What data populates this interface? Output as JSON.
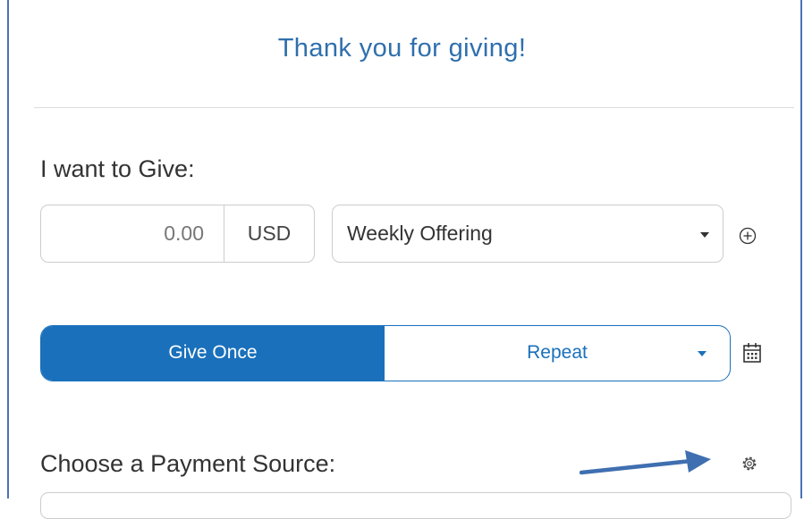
{
  "header": {
    "title": "Thank you for giving!"
  },
  "give_section": {
    "heading": "I want to Give:",
    "amount_value": "0.00",
    "currency": "USD",
    "fund_selected": "Weekly Offering",
    "add_fund_icon": "plus-circle-icon"
  },
  "frequency": {
    "once_label": "Give Once",
    "repeat_label": "Repeat",
    "selected": "Give Once",
    "calendar_icon": "calendar-icon"
  },
  "payment": {
    "heading": "Choose a Payment Source:",
    "settings_icon": "gear-icon"
  },
  "colors": {
    "accent": "#1a70bb",
    "title": "#2f6fad",
    "annotation_arrow": "#3f6fb0",
    "frame": "#4a72b8"
  }
}
